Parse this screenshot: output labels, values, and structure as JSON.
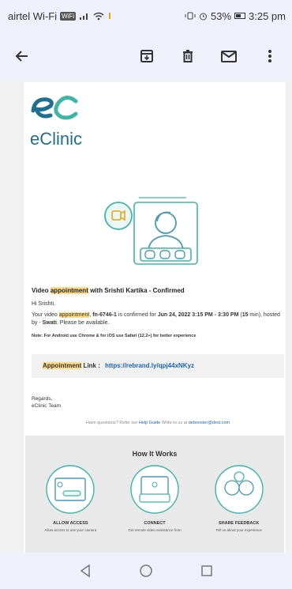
{
  "status_bar": {
    "carrier": "airtel Wi-Fi",
    "wifi_tag": "WiFi",
    "battery": "53%",
    "time": "3:25 pm"
  },
  "toolbar": {
    "back_icon": "arrow-left-icon",
    "icons": [
      "archive-icon",
      "delete-icon",
      "mail-icon",
      "more-vertical-icon"
    ]
  },
  "email": {
    "logo_mark": "eC",
    "logo_text": "eClinic",
    "subject_pre": "Video ",
    "subject_hl": "appointment",
    "subject_post": " with Srishti Kartika - Confirmed",
    "greeting": "Hi Srishti,",
    "body": {
      "p1": "Your video ",
      "hl": "appointment",
      "p2": ", ",
      "id": "fn-6746-1",
      "p3": " is confirmed for ",
      "datetime": "Jun 24, 2022 3:15 PM - 3:30 PM",
      "p4": " (",
      "duration": "15",
      "p5": " min), hosted by - ",
      "host": "Swati",
      "p6": ". Please be available."
    },
    "note": "Note: For Android use Chrome & for iOS use Safari (12.2+) for better experience",
    "appt_label": "Appointment",
    "appt_suffix": " Link :",
    "appt_url": "https://rebrand.ly/qpj44xNKyz",
    "regards": "Regards,",
    "team": "eClinic Team",
    "q_pre": "Have questions? Refer our ",
    "q_help": "Help Guide",
    "q_mid": " Write to us at ",
    "q_email": "debooster@dest.com"
  },
  "how": {
    "title": "How It Works",
    "items": [
      {
        "label": "ALLOW ACCESS",
        "desc": "Allow access to use your camera"
      },
      {
        "label": "CONNECT",
        "desc": "Get remote video assistance from"
      },
      {
        "label": "SHARE FEEDBACK",
        "desc": "Tell us about your experience"
      }
    ]
  },
  "nav": {
    "icons": [
      "back-triangle-icon",
      "home-circle-icon",
      "recents-square-icon"
    ]
  },
  "colors": {
    "brand": "#1f6f91",
    "accent_teal": "#3fb5a8",
    "highlight": "#ffdd88",
    "link": "#1a63b5"
  }
}
